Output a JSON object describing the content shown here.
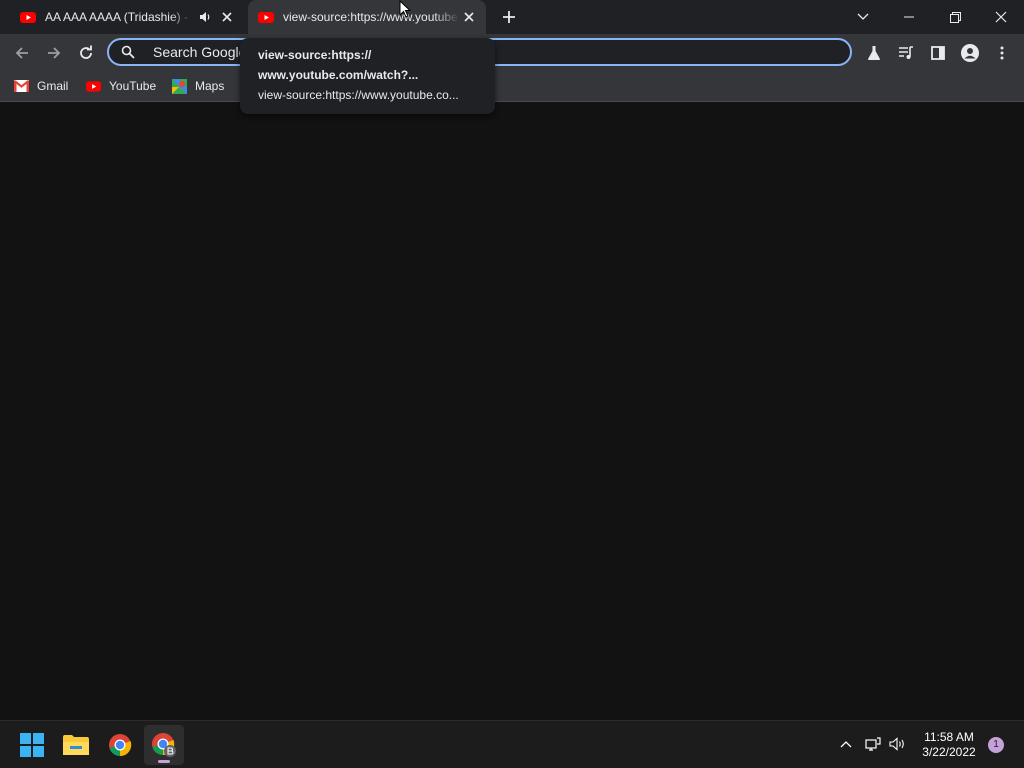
{
  "tabs": [
    {
      "title": "AA AAA AAAA (Tridashie) - Bo",
      "favicon": "youtube-icon",
      "muted_icon": "speaker-icon",
      "active": false
    },
    {
      "title": "view-source:https://www.youtube.com/watch",
      "favicon": "youtube-icon",
      "active": true
    }
  ],
  "omnibox": {
    "placeholder": "Search Google or type a URL"
  },
  "bookmarks": [
    {
      "label": "Gmail",
      "icon": "gmail-icon"
    },
    {
      "label": "YouTube",
      "icon": "youtube-icon"
    },
    {
      "label": "Maps",
      "icon": "maps-icon"
    }
  ],
  "tooltip": {
    "title_line1": "view-source:https://",
    "title_line2": "www.youtube.com/watch?...",
    "url": "view-source:https://www.youtube.co..."
  },
  "taskbar": {
    "apps": [
      "windows-start-icon",
      "file-explorer-icon",
      "chrome-icon",
      "chrome-profile-icon"
    ],
    "time": "11:58 AM",
    "date": "3/22/2022",
    "notification_count": "1"
  },
  "colors": {
    "accent": "#8ab4f8",
    "youtube_red": "#ff0000",
    "toolbar": "#35363a",
    "titlebar": "#202124",
    "content": "#121212"
  }
}
